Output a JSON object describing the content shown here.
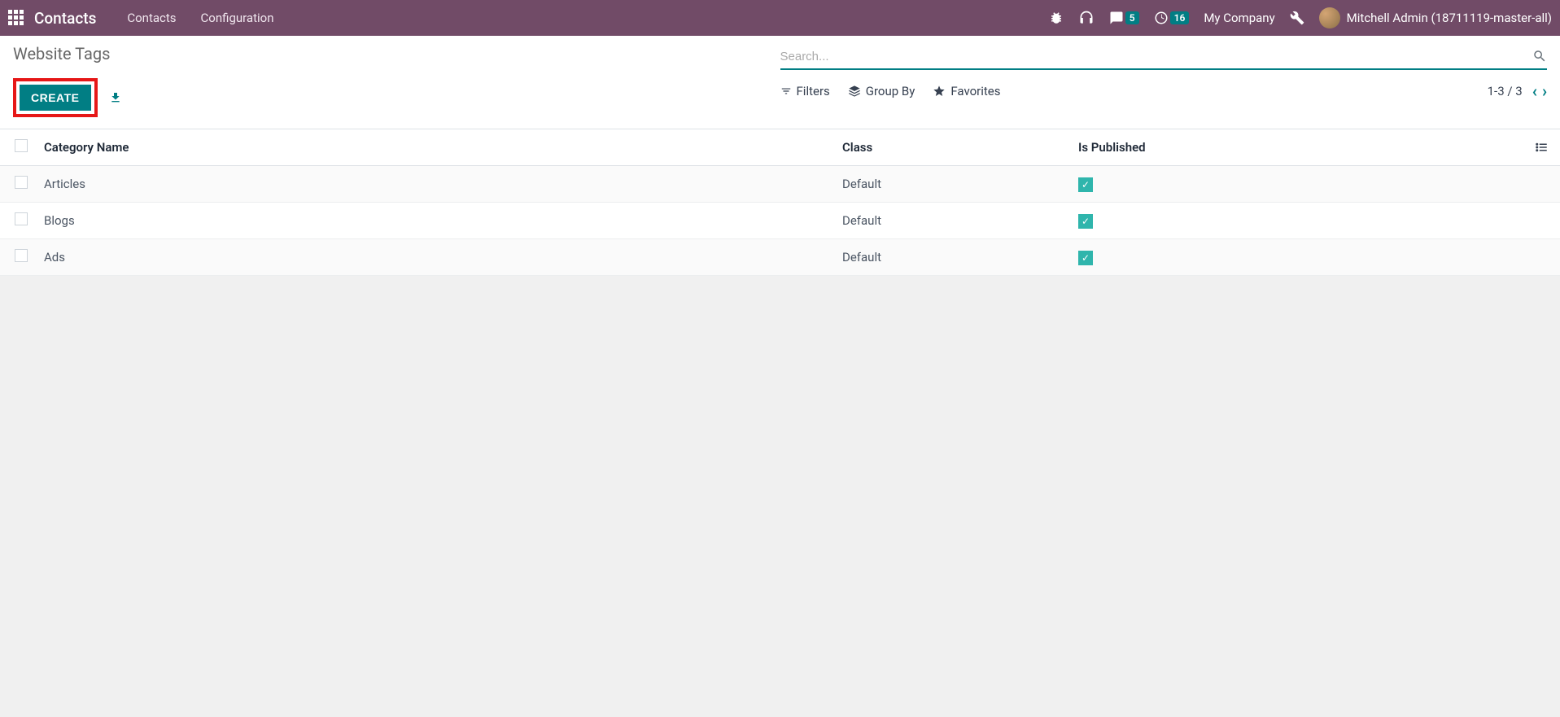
{
  "navbar": {
    "brand": "Contacts",
    "links": [
      "Contacts",
      "Configuration"
    ],
    "chat_badge": "5",
    "activity_badge": "16",
    "company": "My Company",
    "user_name": "Mitchell Admin (18711119-master-all)"
  },
  "breadcrumb": {
    "title": "Website Tags"
  },
  "controls": {
    "create_label": "CREATE",
    "search_placeholder": "Search...",
    "filters_label": "Filters",
    "groupby_label": "Group By",
    "favorites_label": "Favorites",
    "pager": "1-3 / 3"
  },
  "table": {
    "headers": {
      "category": "Category Name",
      "class": "Class",
      "published": "Is Published"
    },
    "rows": [
      {
        "category": "Articles",
        "class": "Default",
        "published": true
      },
      {
        "category": "Blogs",
        "class": "Default",
        "published": true
      },
      {
        "category": "Ads",
        "class": "Default",
        "published": true
      }
    ]
  }
}
